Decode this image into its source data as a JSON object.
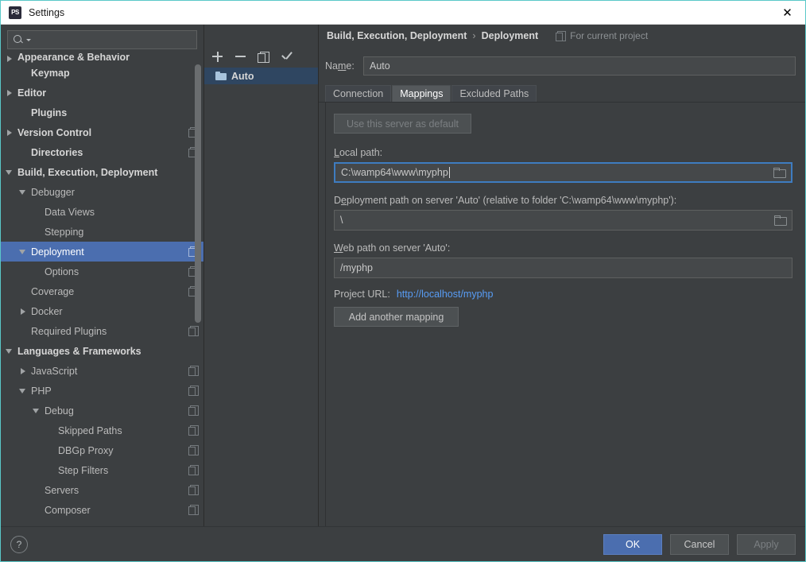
{
  "window": {
    "title": "Settings",
    "app_icon": "PS",
    "close_icon": "✕"
  },
  "sidebar": {
    "search": {
      "value": "",
      "placeholder": "",
      "icon": "search-icon"
    },
    "items": [
      {
        "label": "Appearance & Behavior",
        "indent": 0,
        "arrow": "right",
        "bold": true,
        "clipped": true,
        "project_icon": false
      },
      {
        "label": "Keymap",
        "indent": 1,
        "arrow": "none",
        "bold": true,
        "project_icon": false
      },
      {
        "label": "Editor",
        "indent": 0,
        "arrow": "right",
        "bold": true,
        "project_icon": false
      },
      {
        "label": "Plugins",
        "indent": 1,
        "arrow": "none",
        "bold": true,
        "project_icon": false
      },
      {
        "label": "Version Control",
        "indent": 0,
        "arrow": "right",
        "bold": true,
        "project_icon": true
      },
      {
        "label": "Directories",
        "indent": 1,
        "arrow": "none",
        "bold": true,
        "project_icon": true
      },
      {
        "label": "Build, Execution, Deployment",
        "indent": 0,
        "arrow": "down",
        "bold": true,
        "project_icon": false
      },
      {
        "label": "Debugger",
        "indent": 1,
        "arrow": "down",
        "bold": false,
        "project_icon": false
      },
      {
        "label": "Data Views",
        "indent": 2,
        "arrow": "none",
        "bold": false,
        "project_icon": false
      },
      {
        "label": "Stepping",
        "indent": 2,
        "arrow": "none",
        "bold": false,
        "project_icon": false
      },
      {
        "label": "Deployment",
        "indent": 1,
        "arrow": "down",
        "bold": false,
        "selected": true,
        "project_icon": true
      },
      {
        "label": "Options",
        "indent": 2,
        "arrow": "none",
        "bold": false,
        "project_icon": true
      },
      {
        "label": "Coverage",
        "indent": 1,
        "arrow": "none",
        "bold": false,
        "project_icon": true
      },
      {
        "label": "Docker",
        "indent": 1,
        "arrow": "right",
        "bold": false,
        "project_icon": false
      },
      {
        "label": "Required Plugins",
        "indent": 1,
        "arrow": "none",
        "bold": false,
        "project_icon": true
      },
      {
        "label": "Languages & Frameworks",
        "indent": 0,
        "arrow": "down",
        "bold": true,
        "project_icon": false
      },
      {
        "label": "JavaScript",
        "indent": 1,
        "arrow": "right",
        "bold": false,
        "project_icon": true
      },
      {
        "label": "PHP",
        "indent": 1,
        "arrow": "down",
        "bold": false,
        "project_icon": true
      },
      {
        "label": "Debug",
        "indent": 2,
        "arrow": "down",
        "bold": false,
        "project_icon": true
      },
      {
        "label": "Skipped Paths",
        "indent": 3,
        "arrow": "none",
        "bold": false,
        "project_icon": true
      },
      {
        "label": "DBGp Proxy",
        "indent": 3,
        "arrow": "none",
        "bold": false,
        "project_icon": true
      },
      {
        "label": "Step Filters",
        "indent": 3,
        "arrow": "none",
        "bold": false,
        "project_icon": true
      },
      {
        "label": "Servers",
        "indent": 2,
        "arrow": "none",
        "bold": false,
        "project_icon": true
      },
      {
        "label": "Composer",
        "indent": 2,
        "arrow": "none",
        "bold": false,
        "project_icon": true
      }
    ]
  },
  "breadcrumb": {
    "parent": "Build, Execution, Deployment",
    "separator": "›",
    "current": "Deployment",
    "scope_note": "For current project"
  },
  "server_panel": {
    "toolbar": [
      {
        "name": "add-server-button",
        "icon": "plus-icon"
      },
      {
        "name": "remove-server-button",
        "icon": "minus-icon"
      },
      {
        "name": "copy-server-button",
        "icon": "copy-icon"
      },
      {
        "name": "set-default-server-button",
        "icon": "check-icon"
      }
    ],
    "servers": [
      {
        "label": "Auto",
        "selected": true,
        "icon": "folder-icon"
      }
    ]
  },
  "main": {
    "name_label": "Na",
    "name_label_underline": "m",
    "name_label_rest": "e:",
    "name_value": "Auto",
    "tabs": [
      {
        "label": "Connection",
        "active": false
      },
      {
        "label": "Mappings",
        "active": true
      },
      {
        "label": "Excluded Paths",
        "active": false
      }
    ],
    "use_default_button": "Use this server as default",
    "local_path": {
      "label_pre": "",
      "label_underline": "L",
      "label_rest": "ocal path:",
      "value": "C:\\wamp64\\www\\myphp",
      "focused": true,
      "browse_icon": "folder-browse-icon"
    },
    "deployment_path": {
      "label_pre": "D",
      "label_underline": "e",
      "label_rest": "ployment path on server 'Auto' (relative to folder 'C:\\wamp64\\www\\myphp'):",
      "value": "\\",
      "focused": false,
      "browse_icon": "folder-browse-icon"
    },
    "web_path": {
      "label_pre": "",
      "label_underline": "W",
      "label_rest": "eb path on server 'Auto':",
      "value": "/myphp"
    },
    "project_url_label": "Project URL:",
    "project_url_value": "http://localhost/myphp",
    "add_mapping_button": "Add another mapping"
  },
  "footer": {
    "help_icon": "?",
    "buttons": [
      {
        "label": "OK",
        "style": "primary"
      },
      {
        "label": "Cancel",
        "style": "normal"
      },
      {
        "label": "Apply",
        "style": "disabled"
      }
    ]
  },
  "colors": {
    "background": "#3c3f41",
    "accent": "#4b6eaf",
    "link": "#589df6",
    "focus_border": "#3e7cc0",
    "selected_server": "#2f4661"
  }
}
